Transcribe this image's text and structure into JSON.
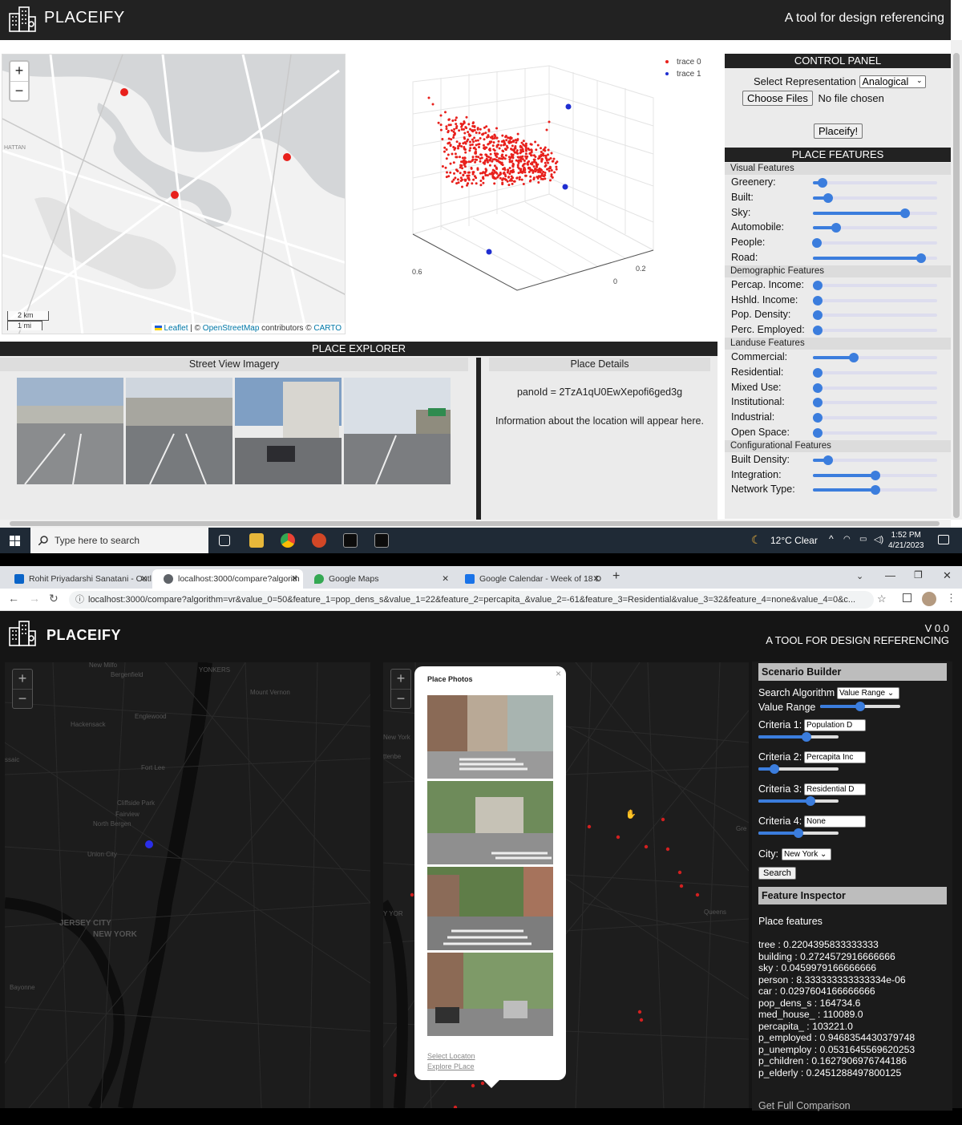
{
  "top_app": {
    "brand": "PLACEIFY",
    "tagline": "A tool for design referencing",
    "map": {
      "zoom_in": "+",
      "zoom_out": "−",
      "scale_km": "2 km",
      "scale_mi": "1 mi",
      "place_label": "HATTAN",
      "attribution": {
        "leaflet": "Leaflet",
        "sep": " | © ",
        "osm": "OpenStreetMap",
        "mid": " contributors © ",
        "carto": "CARTO"
      }
    },
    "plot": {
      "legend": [
        {
          "name": "trace 0",
          "color": "#e8201c"
        },
        {
          "name": "trace 1",
          "color": "#1f2ed1"
        }
      ],
      "tick_labels": [
        "0.6",
        "0.2",
        "0",
        "0 -"
      ]
    },
    "control_panel": {
      "title": "CONTROL PANEL",
      "select_label": "Select Representation",
      "select_value": "Analogical",
      "choose_files": "Choose Files",
      "no_file": "No file chosen",
      "placeify_button": "Placeify!"
    },
    "place_features": {
      "title": "PLACE FEATURES",
      "groups": [
        {
          "name": "Visual Features",
          "items": [
            {
              "label": "Greenery:",
              "value": 0.08
            },
            {
              "label": "Built:",
              "value": 0.12
            },
            {
              "label": "Sky:",
              "value": 0.74
            },
            {
              "label": "Automobile:",
              "value": 0.19
            },
            {
              "label": "People:",
              "value": 0.03
            },
            {
              "label": "Road:",
              "value": 0.87
            }
          ]
        },
        {
          "name": "Demographic Features",
          "items": [
            {
              "label": "Percap. Income:",
              "value": 0.04
            },
            {
              "label": "Hshld. Income:",
              "value": 0.04
            },
            {
              "label": "Pop. Density:",
              "value": 0.04
            },
            {
              "label": "Perc. Employed:",
              "value": 0.04
            }
          ]
        },
        {
          "name": "Landuse Features",
          "items": [
            {
              "label": "Commercial:",
              "value": 0.33
            },
            {
              "label": "Residential:",
              "value": 0.04
            },
            {
              "label": "Mixed Use:",
              "value": 0.04
            },
            {
              "label": "Institutional:",
              "value": 0.04
            },
            {
              "label": "Industrial:",
              "value": 0.04
            },
            {
              "label": "Open Space:",
              "value": 0.04
            }
          ]
        },
        {
          "name": "Configurational Features",
          "items": [
            {
              "label": "Built Density:",
              "value": 0.12
            },
            {
              "label": "Integration:",
              "value": 0.5
            },
            {
              "label": "Network Type:",
              "value": 0.5
            }
          ]
        }
      ]
    },
    "explorer": {
      "title": "PLACE EXPLORER",
      "street_view": "Street View Imagery",
      "details": "Place Details",
      "pano_id": "panoId = 2TzA1qU0EwXepofi6ged3g",
      "info": "Information about the location will appear here."
    }
  },
  "taskbar": {
    "search_placeholder": "Type here to search",
    "weather": "12°C  Clear",
    "time": "1:52 PM",
    "date": "4/21/2023"
  },
  "browser": {
    "tabs": [
      {
        "title": "Rohit Priyadarshi Sanatani - Outl",
        "color": "#0a64c8"
      },
      {
        "title": "localhost:3000/compare?algorith",
        "color": "#5f6368"
      },
      {
        "title": "Google Maps",
        "color": "#34a853"
      },
      {
        "title": "Google Calendar - Week of 18 D",
        "color": "#1a73e8"
      }
    ],
    "new_tab": "+",
    "url": "localhost:3000/compare?algorithm=vr&value_0=50&feature_1=pop_dens_s&value_1=22&feature_2=percapita_&value_2=-61&feature_3=Residential&value_3=32&feature_4=none&value_4=0&c..."
  },
  "app2": {
    "brand": "PLACEIFY",
    "version": "V 0.0",
    "tagline": "A TOOL FOR DESIGN REFERENCING",
    "map_labels": [
      "New Milfo",
      "Bergenfield",
      "YONKERS",
      "Mount Vernon",
      "Hackensack",
      "Englewood",
      "Fort Lee",
      "Cliffside Park",
      "Fairview",
      "North Bergen",
      "Union City",
      "JERSEY CITY",
      "NEW YORK",
      "Bayonne",
      "ssaic",
      "ttenbe",
      "New York",
      "Y YOR",
      "Gre",
      "Queens"
    ],
    "popup": {
      "title": "Place Photos",
      "close": "×",
      "select_location": "Select Locaton",
      "explore_place": "Explore PLace"
    },
    "scenario": {
      "title": "Scenario Builder",
      "algo_label": "Search Algorithm",
      "algo_value": "Value Range",
      "value_range": "Value Range",
      "criteria": [
        {
          "label": "Criteria 1:",
          "value": "Population D",
          "level": 0.6
        },
        {
          "label": "Criteria 2:",
          "value": "Percapita Inc",
          "level": 0.2
        },
        {
          "label": "Criteria 3:",
          "value": "Residential D",
          "level": 0.65
        },
        {
          "label": "Criteria 4:",
          "value": "None",
          "level": 0.5
        }
      ],
      "value_range_level": 0.5,
      "city_label": "City:",
      "city_value": "New York",
      "search_button": "Search"
    },
    "inspector": {
      "title": "Feature Inspector",
      "subtitle": "Place features",
      "lines": [
        "tree : 0.2204395833333333",
        "building : 0.2724572916666666",
        "sky : 0.0459979166666666",
        "person : 8.333333333333334e-06",
        "car : 0.0297604166666666",
        "pop_dens_s : 164734.6",
        "med_house_ : 110089.0",
        "percapita_ : 103221.0",
        "p_employed : 0.9468354430379748",
        "p_unemploy : 0.0531645569620253",
        "p_children : 0.1627906976744186",
        "p_elderly : 0.2451288497800125"
      ],
      "full_comparison": "Get Full Comparison"
    }
  }
}
